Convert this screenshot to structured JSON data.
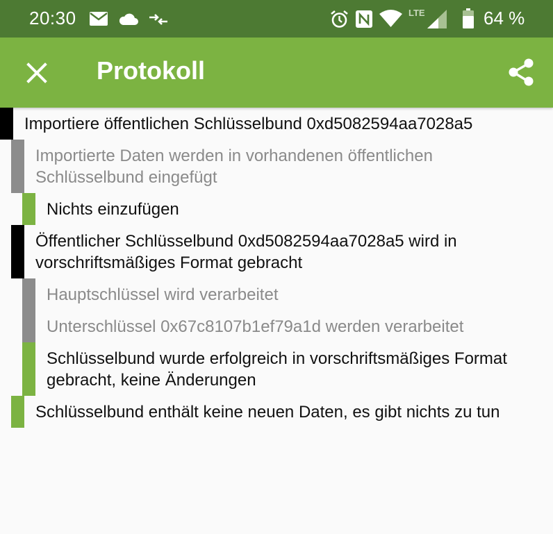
{
  "status_bar": {
    "time": "20:30",
    "battery_percent": "64 %",
    "network": "LTE",
    "icons": [
      "mail-icon",
      "cloud-icon",
      "data-transfer-icon",
      "alarm-icon",
      "nfc-icon",
      "wifi-icon",
      "cell-signal-icon",
      "battery-icon"
    ]
  },
  "app_bar": {
    "title": "Protokoll",
    "close_icon": "close-icon",
    "share_icon": "share-icon"
  },
  "colors": {
    "status_bar": "#4d7a33",
    "app_bar": "#7cb342",
    "black_marker": "#000000",
    "gray_marker": "#8c8c8c",
    "green_marker": "#7cb342",
    "muted_text": "#8a8a8a"
  },
  "log_entries": [
    {
      "text": "Importiere öffentlichen Schlüsselbund 0xd5082594aa7028a5",
      "level": 0,
      "marker": "black",
      "muted": false
    },
    {
      "text": "Importierte Daten werden in vorhandenen öffentlichen Schlüsselbund eingefügt",
      "level": 1,
      "marker": "gray",
      "muted": true
    },
    {
      "text": "Nichts einzufügen",
      "level": 2,
      "marker": "green",
      "muted": false
    },
    {
      "text": "Öffentlicher Schlüsselbund 0xd5082594aa7028a5 wird in vorschriftsmäßiges Format gebracht",
      "level": 1,
      "marker": "black",
      "muted": false
    },
    {
      "text": "Hauptschlüssel wird verarbeitet",
      "level": 2,
      "marker": "gray",
      "muted": true
    },
    {
      "text": "Unterschlüssel 0x67c8107b1ef79a1d werden verarbeitet",
      "level": 2,
      "marker": "gray",
      "muted": true
    },
    {
      "text": "Schlüsselbund wurde erfolgreich in vorschriftsmäßiges Format gebracht, keine Änderungen",
      "level": 2,
      "marker": "green",
      "muted": false
    },
    {
      "text": "Schlüsselbund enthält keine neuen Daten, es gibt nichts zu tun",
      "level": 1,
      "marker": "green",
      "muted": false
    }
  ]
}
